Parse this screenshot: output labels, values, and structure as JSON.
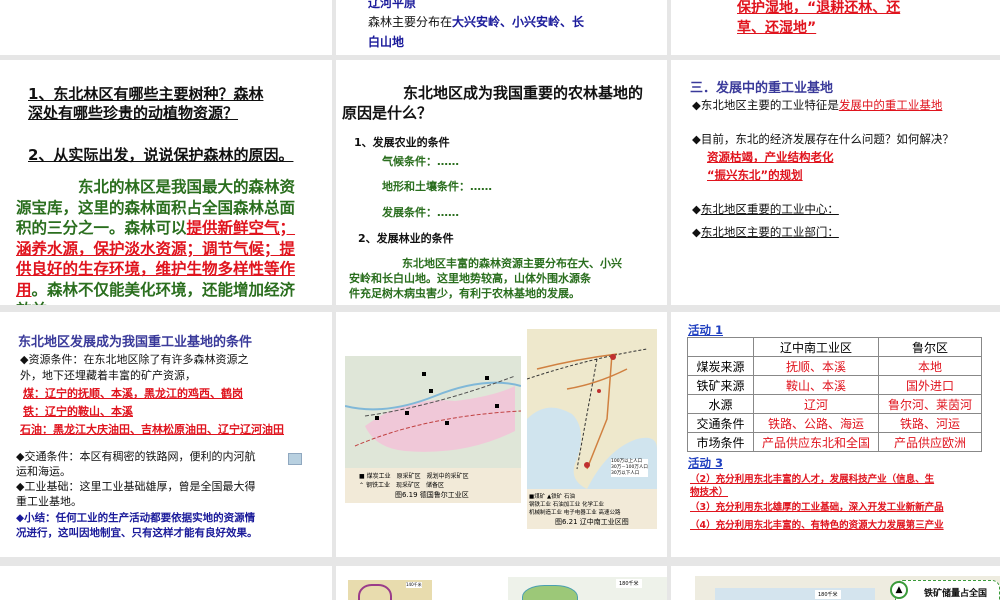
{
  "slides_top": {
    "mid": {
      "line0": "辽河平原",
      "line1_prefix": "森林主要分布在",
      "line1_highlight": "大兴安岭、小兴安岭、长",
      "line2": "白山地"
    },
    "right": {
      "line1": "保护湿地，“退耕还林、还",
      "line2": "草、还湿地”"
    }
  },
  "slide_forest": {
    "q1a": "1、东北林区有哪些主要树种？森林",
    "q1b": "深处有哪些珍贵的动植物资源？",
    "q2": "2、从实际出发，说说保护森林的原因。",
    "p1": "东北的林区是我国最大的森林资",
    "p2": "源宝库，这里的森林面积占全国森林总面",
    "p3a": "积的三分之一。森林可以",
    "p3b": "提供新鲜空气；",
    "p4": "涵养水源，保护淡水资源；调节气候；提",
    "p5": "供良好的生存环境，维护生物多样性等作",
    "p6a": "用",
    "p6b": "。森林不仅能美化环境，还能增加经济",
    "p7": "效益"
  },
  "slide_agri": {
    "title1": "东北地区成为我国重要的农林基地的",
    "title2": "原因是什么？",
    "h1": "1、发展农业的条件",
    "c1": "气候条件：……",
    "c2": "地形和土壤条件：……",
    "c3": "发展条件：……",
    "h2": "2、发展林业的条件",
    "g1": "东北地区丰富的森林资源主要分布在大、小兴",
    "g2": "安岭和长白山地。这里地势较高，山体外围水源条",
    "g3": "件充足树木病虫害少，有利于农林基地的发展。"
  },
  "slide_industry": {
    "title": "三．发展中的重工业基地",
    "b1": "◆东北地区主要的工业特征是",
    "b1r": "发展中的重工业基地",
    "b2": "◆目前，东北的经济发展存在什么问题？如何解决？",
    "r1": "资源枯竭，产业结构老化",
    "r2": "“振兴东北”的规划",
    "b3": "东北地区重要的工业中心：",
    "b4": "东北地区主要的工业部门："
  },
  "slide_conditions": {
    "title": "东北地区发展成为我国重工业基地的条件",
    "l1": "◆资源条件：在东北地区除了有许多森林资源之",
    "l2": "外，地下还埋藏着丰富的矿产资源，",
    "coal": "煤：辽宁的抚顺、本溪，黑龙江的鸡西、鹤岗",
    "iron": "铁：辽宁的鞍山、本溪",
    "oil": "石油：黑龙江大庆油田、吉林松原油田、辽宁辽河油田",
    "t1": "◆交通条件：本区有稠密的铁路网，便利的内河航",
    "t2": "运和海运。",
    "i1": "◆工业基础：这里工业基础雄厚，曾是全国最大得",
    "i2": "重工业基地。",
    "s1": "◆小结：任何工业的生产活动都要依据实地的资源情",
    "s2": "况进行，这叫因地制宜、只有这样才能有良好效果。"
  },
  "slide_maps": {
    "ruhr_caption": "图6.19 德国鲁尔工业区",
    "ruhr_legend": [
      "煤炭工业",
      "钢铁工业",
      "原采矿区",
      "现采矿区",
      "规划中的采矿区",
      "储备区"
    ],
    "liao_caption": "图6.21 辽中南工业区图",
    "liao_legend": [
      "煤矿",
      "铁矿",
      "石油",
      "钢铁工业",
      "石油加工业",
      "化学工业",
      "机械制造工业",
      "电子电器工业",
      "高速公路"
    ],
    "liao_pop": [
      "100万以上人口",
      "30万－100万人口",
      "30万以下人口"
    ]
  },
  "slide_activity": {
    "act1": "活动 1",
    "headers": [
      "",
      "辽中南工业区",
      "鲁尔区"
    ],
    "rows": [
      [
        "煤炭来源",
        "抚顺、本溪",
        "本地"
      ],
      [
        "铁矿来源",
        "鞍山、本溪",
        "国外进口"
      ],
      [
        "水源",
        "辽河",
        "鲁尔河、莱茵河"
      ],
      [
        "交通条件",
        "铁路、公路、海运",
        "铁路、河运"
      ],
      [
        "市场条件",
        "产品供应东北和全国",
        "产品供应欧洲"
      ]
    ],
    "act3": "活动 3",
    "a2a": "（2）充分利用东北丰富的人才，发展科技产业（信息、生",
    "a2b": "物技术）",
    "a3": "（3）充分利用东北雄厚的工业基础，深入开发工业新新产品",
    "a4": "（4）充分利用东北丰富的、有特色的资源大力发展第三产业"
  },
  "slide_bottom": {
    "scale1": "140千米",
    "scale2": "180千米",
    "scale3": "180千米",
    "note": "铁矿储量占全国"
  }
}
